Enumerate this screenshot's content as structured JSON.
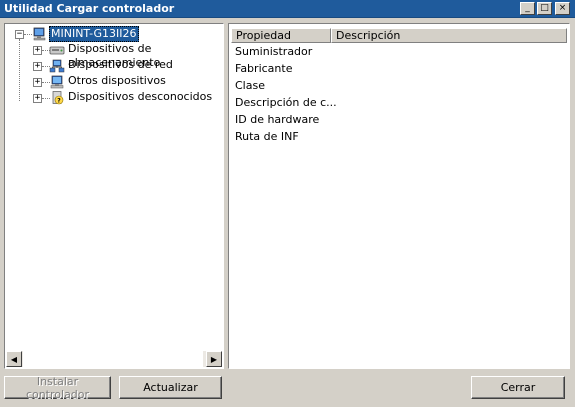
{
  "window": {
    "title": "Utilidad Cargar controlador",
    "minimize_glyph": "_",
    "maximize_glyph": "□",
    "close_glyph": "×"
  },
  "tree": {
    "root": {
      "label": "MININT-G13II26",
      "expander": "−"
    },
    "children": [
      {
        "label": "Dispositivos de almacenamiento",
        "expander": "+",
        "icon": "storage-icon"
      },
      {
        "label": "Dispositivos de red",
        "expander": "+",
        "icon": "network-icon"
      },
      {
        "label": "Otros dispositivos",
        "expander": "+",
        "icon": "other-devices-icon"
      },
      {
        "label": "Dispositivos desconocidos",
        "expander": "+",
        "icon": "unknown-device-icon"
      }
    ],
    "scroll_left": "◀",
    "scroll_right": "▶"
  },
  "properties": {
    "columns": [
      "Propiedad",
      "Descripción"
    ],
    "rows": [
      "Suministrador",
      "Fabricante",
      "Clase",
      "Descripción de c...",
      "ID de hardware",
      "Ruta de INF"
    ]
  },
  "buttons": {
    "install": "Instalar controlador",
    "refresh": "Actualizar",
    "close": "Cerrar"
  }
}
